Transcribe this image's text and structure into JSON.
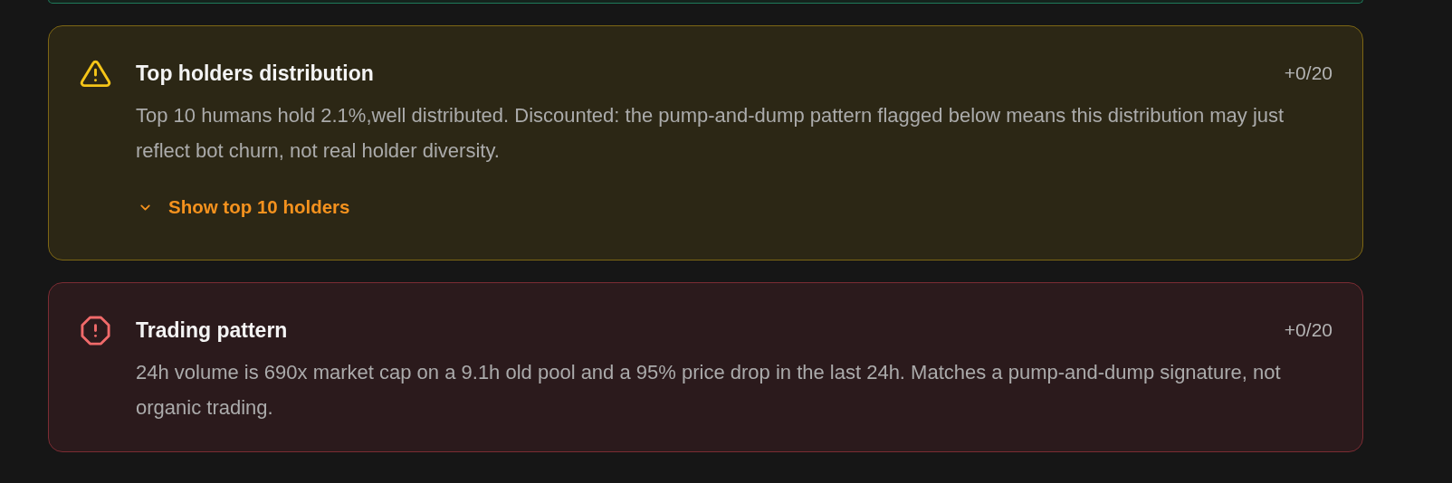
{
  "card_above": {
    "kind": "success"
  },
  "checks": [
    {
      "kind": "warning",
      "title": "Top holders distribution",
      "score": "+0/20",
      "description": "Top 10 humans hold 2.1%,well distributed. Discounted: the pump-and-dump pattern flagged below means this distribution may just reflect bot churn, not real holder diversity.",
      "toggle": {
        "label": "Show top 10 holders",
        "expanded": false
      }
    },
    {
      "kind": "danger",
      "title": "Trading pattern",
      "score": "+0/20",
      "description": "24h volume is 690x market cap on a 9.1h old pool and a 95% price drop in the last 24h. Matches a pump-and-dump signature, not organic trading."
    }
  ]
}
